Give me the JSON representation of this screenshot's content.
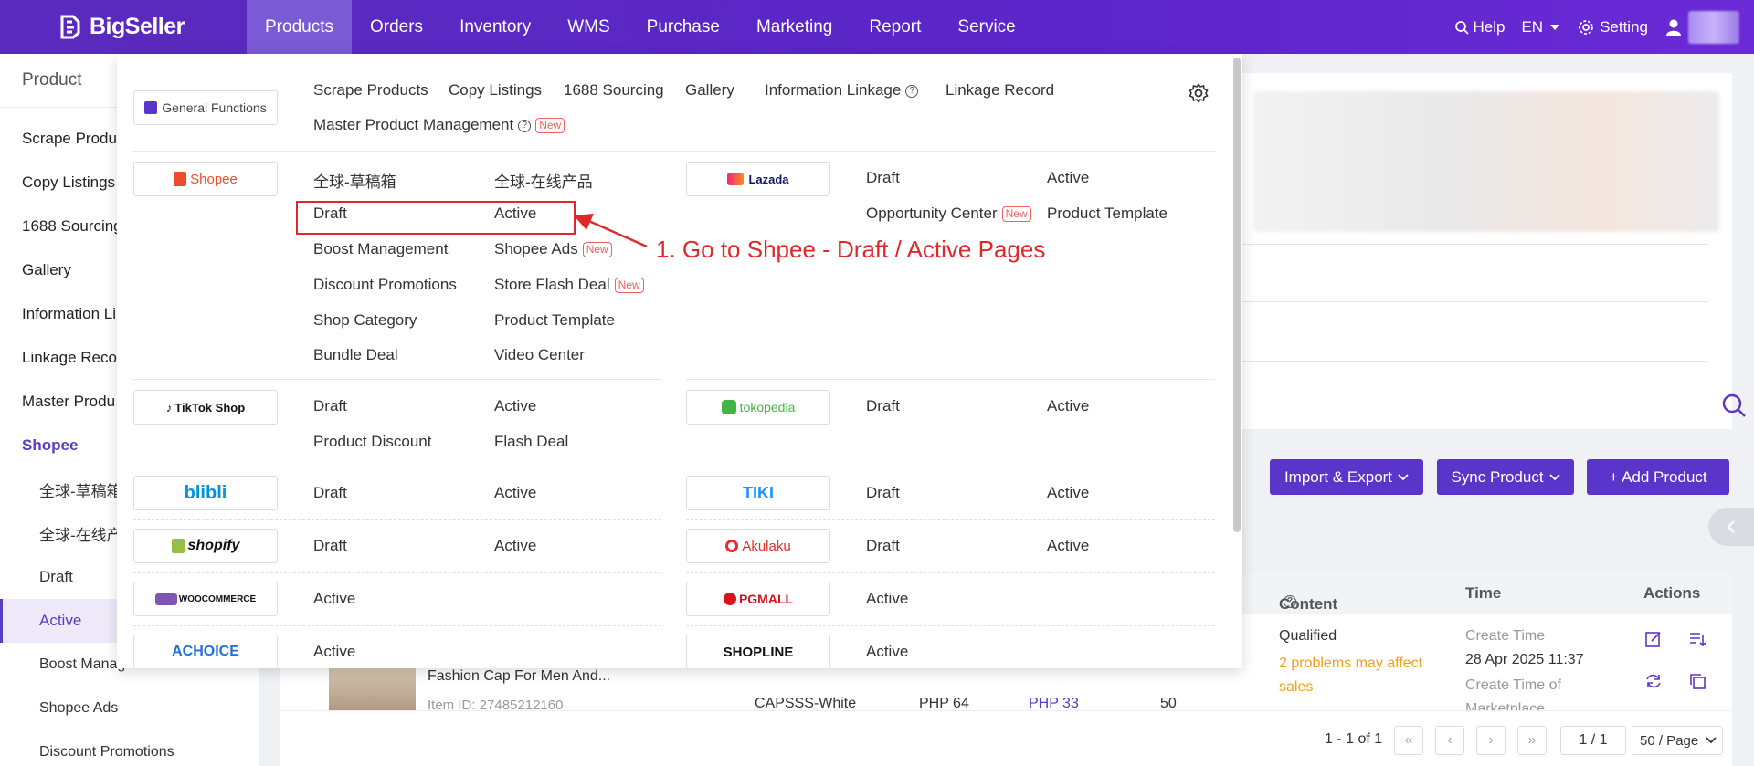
{
  "brand": "BigSeller",
  "nav": {
    "items": [
      "Products",
      "Orders",
      "Inventory",
      "WMS",
      "Purchase",
      "Marketing",
      "Report",
      "Service"
    ],
    "help": "Help",
    "lang": "EN",
    "setting": "Setting"
  },
  "sidebar": {
    "title": "Product",
    "items": [
      "Scrape Produ",
      "Copy Listings",
      "1688 Sourcing",
      "Gallery",
      "Information Li",
      "Linkage Reco",
      "Master Produ"
    ],
    "shopee": "Shopee",
    "subitems": [
      "全球-草稿箱",
      "全球-在线产",
      "Draft",
      "Active",
      "Boost Management",
      "Shopee Ads",
      "Discount Promotions"
    ]
  },
  "dropdown": {
    "general_functions": "General Functions",
    "general_links": [
      "Scrape Products",
      "Copy Listings",
      "1688 Sourcing",
      "Gallery",
      "Information Linkage",
      "Linkage Record"
    ],
    "master": "Master Product Management",
    "new_badge": "New",
    "shopee": {
      "logo": "Shopee",
      "links": [
        "全球-草稿箱",
        "全球-在线产品",
        "Draft",
        "Active",
        "Boost Management",
        "Shopee Ads",
        "Discount Promotions",
        "Store Flash Deal",
        "Shop Category",
        "Product Template",
        "Bundle Deal",
        "Video Center"
      ]
    },
    "lazada": {
      "logo": "Lazada",
      "links": [
        "Draft",
        "Active",
        "Opportunity Center",
        "Product Template"
      ]
    },
    "tiktok": {
      "logo": "TikTok Shop",
      "links": [
        "Draft",
        "Active",
        "Product Discount",
        "Flash Deal"
      ]
    },
    "tokopedia": {
      "logo": "tokopedia",
      "links": [
        "Draft",
        "Active"
      ]
    },
    "blibli": {
      "logo": "blibli",
      "links": [
        "Draft",
        "Active"
      ]
    },
    "tiki": {
      "logo": "TIKI",
      "links": [
        "Draft",
        "Active"
      ]
    },
    "shopify": {
      "logo": "shopify",
      "links": [
        "Draft",
        "Active"
      ]
    },
    "akulaku": {
      "logo": "Akulaku",
      "links": [
        "Draft",
        "Active"
      ]
    },
    "woo": {
      "logo": "WOOCOMMERCE",
      "links": [
        "Active"
      ]
    },
    "pgmall": {
      "logo": "PGMALL",
      "links": [
        "Active"
      ]
    },
    "achoice": {
      "logo": "ACHOICE",
      "links": [
        "Active"
      ]
    },
    "shopline": {
      "logo": "SHOPLINE",
      "links": [
        "Active"
      ]
    }
  },
  "annotation": "1. Go to Shpee - Draft / Active Pages",
  "buttons": {
    "import_export": "Import & Export",
    "sync": "Sync Product",
    "add": "+ Add Product"
  },
  "table": {
    "headers": [
      "Content Quality",
      "Time",
      "Actions"
    ],
    "quality": "Qualified",
    "problems": "2 problems may affect sales",
    "create_time_label": "Create Time",
    "create_time": "28 Apr 2025 11:37",
    "create_mkt": "Create Time of Marketplace",
    "product_name": "Fashion Cap For Men And...",
    "item_id": "Item ID: 27485212160",
    "sku": "CAPSSS-White",
    "price": "PHP 64",
    "sale_price": "PHP 33",
    "stock": "50"
  },
  "pagination": {
    "range": "1 - 1 of 1",
    "page": "1 / 1",
    "per_page": "50 / Page"
  }
}
